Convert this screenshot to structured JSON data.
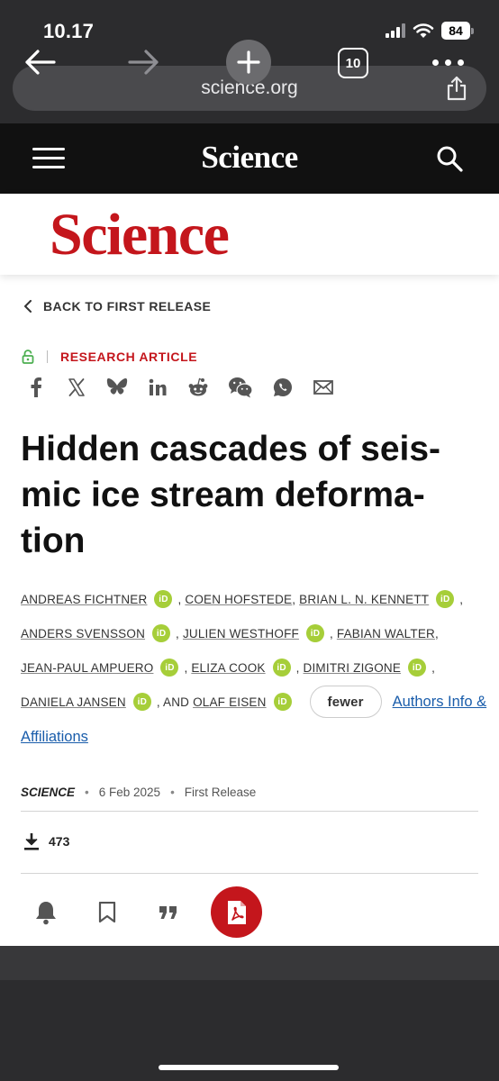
{
  "status_bar": {
    "time": "10.17",
    "battery": "84"
  },
  "browser": {
    "url": "science.org",
    "tab_count": "10"
  },
  "nav": {
    "logo": "Science"
  },
  "banner": {
    "logo": "Science"
  },
  "back_link": "BACK TO FIRST RELEASE",
  "article_type": "RESEARCH ARTICLE",
  "share_icons": [
    "facebook-icon",
    "x-icon",
    "bluesky-icon",
    "linkedin-icon",
    "reddit-icon",
    "wechat-icon",
    "whatsapp-icon",
    "email-icon"
  ],
  "title_lines": [
    "Hidden cascades of seis-",
    "mic ice stream deforma-",
    "tion"
  ],
  "authors": {
    "a1": "ANDREAS FICHTNER",
    "a2": "COEN HOFSTEDE",
    "a3": "BRIAN L. N. KENNETT",
    "a4": "ANDERS SVENSSON",
    "a5": "JULIEN WESTHOFF",
    "a6": "FABIAN WALTER",
    "a7": "JEAN-PAUL AMPUERO",
    "a8": "ELIZA COOK",
    "a9": "DIMITRI ZIGONE",
    "a10": "DANIELA JANSEN",
    "a11": "OLAF EISEN",
    "orcid": "iD",
    "comma": ",",
    "and": ", AND",
    "fewer_label": "fewer",
    "affiliations_1": "Authors Info &",
    "affiliations_2": "Affiliations"
  },
  "meta": {
    "journal": "SCIENCE",
    "bullet": "•",
    "date": "6 Feb 2025",
    "release": "First Release"
  },
  "downloads": "473",
  "colors": {
    "brand_red": "#c4161c",
    "orcid_green": "#a6ce39",
    "link_blue": "#1a5dab",
    "chrome": "#2c2c2e"
  }
}
